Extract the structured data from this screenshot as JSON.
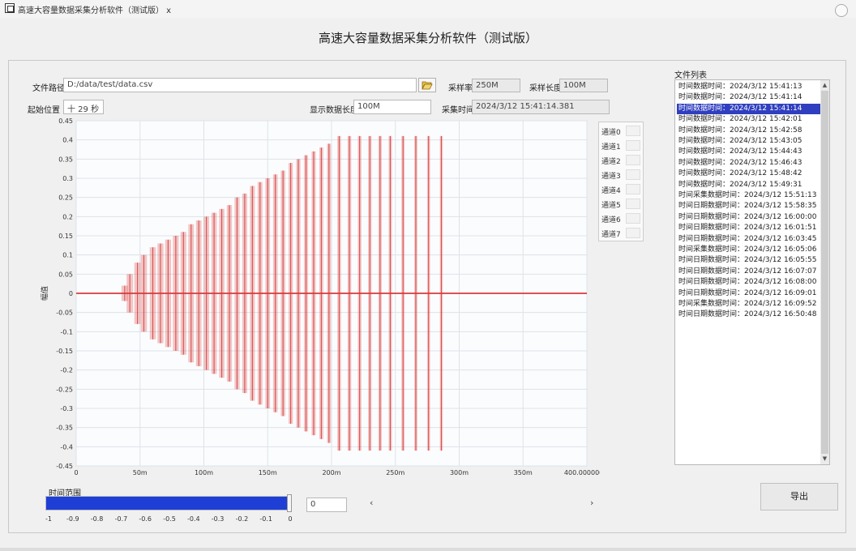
{
  "window": {
    "title": "高速大容量数据采集分析软件（测试版） x",
    "close_icon": "close-icon"
  },
  "app_heading": "高速大容量数据采集分析软件（测试版）",
  "form": {
    "file_path_label": "文件路径",
    "file_path_value": "D:/data/test/data.csv",
    "browse_icon": "folder-open-icon",
    "sample_rate_label": "采样率",
    "sample_rate_value": "250M",
    "bandwidth_label": "采样长度",
    "bandwidth_value": "100M",
    "position_label": "起始位置",
    "position_value": "十 29 秒",
    "display_length_label": "显示数据长度",
    "display_length_value": "100M",
    "time_label": "采集时间",
    "time_value": "2024/3/12 15:41:14.381"
  },
  "chart_data": {
    "type": "line",
    "title": "",
    "xlabel": "",
    "ylabel": "幅值",
    "ylim": [
      -0.45,
      0.45
    ],
    "xlim": [
      0,
      400000000
    ],
    "yticks": [
      "0.45",
      "0.4",
      "0.35",
      "0.3",
      "0.25",
      "0.2",
      "0.15",
      "0.1",
      "0.05",
      "0",
      "-0.05",
      "-0.1",
      "-0.15",
      "-0.2",
      "-0.25",
      "-0.3",
      "-0.35",
      "-0.4",
      "-0.45"
    ],
    "xticks": [
      "0",
      "50m",
      "100m",
      "150m",
      "200m",
      "250m",
      "300m",
      "350m",
      "400.000000m"
    ],
    "grid": true,
    "series_color": "#d83a3a",
    "series": [
      {
        "name": "",
        "bursts": [
          {
            "x": 38000000,
            "amp": 0.02
          },
          {
            "x": 42000000,
            "amp": 0.05
          },
          {
            "x": 48000000,
            "amp": 0.08
          },
          {
            "x": 53000000,
            "amp": 0.1
          },
          {
            "x": 60000000,
            "amp": 0.12
          },
          {
            "x": 66000000,
            "amp": 0.13
          },
          {
            "x": 72000000,
            "amp": 0.14
          },
          {
            "x": 78000000,
            "amp": 0.15
          },
          {
            "x": 84000000,
            "amp": 0.16
          },
          {
            "x": 90000000,
            "amp": 0.18
          },
          {
            "x": 96000000,
            "amp": 0.19
          },
          {
            "x": 102000000,
            "amp": 0.2
          },
          {
            "x": 108000000,
            "amp": 0.21
          },
          {
            "x": 114000000,
            "amp": 0.22
          },
          {
            "x": 120000000,
            "amp": 0.23
          },
          {
            "x": 126000000,
            "amp": 0.25
          },
          {
            "x": 132000000,
            "amp": 0.26
          },
          {
            "x": 138000000,
            "amp": 0.28
          },
          {
            "x": 144000000,
            "amp": 0.29
          },
          {
            "x": 150000000,
            "amp": 0.3
          },
          {
            "x": 156000000,
            "amp": 0.31
          },
          {
            "x": 162000000,
            "amp": 0.32
          },
          {
            "x": 168000000,
            "amp": 0.34
          },
          {
            "x": 174000000,
            "amp": 0.35
          },
          {
            "x": 180000000,
            "amp": 0.36
          },
          {
            "x": 186000000,
            "amp": 0.37
          },
          {
            "x": 192000000,
            "amp": 0.38
          },
          {
            "x": 198000000,
            "amp": 0.39
          },
          {
            "x": 206000000,
            "amp": 0.41
          },
          {
            "x": 214000000,
            "amp": 0.41
          },
          {
            "x": 222000000,
            "amp": 0.41
          },
          {
            "x": 230000000,
            "amp": 0.41
          },
          {
            "x": 238000000,
            "amp": 0.41
          },
          {
            "x": 246000000,
            "amp": 0.41
          },
          {
            "x": 256000000,
            "amp": 0.41
          },
          {
            "x": 266000000,
            "amp": 0.41
          },
          {
            "x": 276000000,
            "amp": 0.41
          },
          {
            "x": 286000000,
            "amp": 0.41
          }
        ]
      }
    ]
  },
  "legend": {
    "items": [
      {
        "label": "通道0"
      },
      {
        "label": "通道1"
      },
      {
        "label": "通道2"
      },
      {
        "label": "通道3"
      },
      {
        "label": "通道4"
      },
      {
        "label": "通道5"
      },
      {
        "label": "通道6"
      },
      {
        "label": "通道7"
      }
    ]
  },
  "file_list": {
    "label": "文件列表",
    "items": [
      "时间数据时间：2024/3/12 15:41:13",
      "时间数据时间：2024/3/12 15:41:14",
      "时间数据时间：2024/3/12 15:41:14",
      "时间数据时间：2024/3/12 15:42:01",
      "时间数据时间：2024/3/12 15:42:58",
      "时间数据时间：2024/3/12 15:43:05",
      "时间数据时间：2024/3/12 15:44:43",
      "时间数据时间：2024/3/12 15:46:43",
      "时间数据时间：2024/3/12 15:48:42",
      "时间数据时间：2024/3/12 15:49:31",
      "时间采集数据时间：2024/3/12 15:51:13",
      "时间日期数据时间：2024/3/12 15:58:35",
      "时间日期数据时间：2024/3/12 16:00:00",
      "时间日期数据时间：2024/3/12 16:01:51",
      "时间日期数据时间：2024/3/12 16:03:45",
      "时间采集数据时间：2024/3/12 16:05:06",
      "时间日期数据时间：2024/3/12 16:05:55",
      "时间日期数据时间：2024/3/12 16:07:07",
      "时间日期数据时间：2024/3/12 16:08:00",
      "时间日期数据时间：2024/3/12 16:09:01",
      "时间采集数据时间：2024/3/12 16:09:52",
      "时间日期数据时间：2024/3/12 16:50:48"
    ],
    "selected_index": 2
  },
  "progress": {
    "label": "时间范围",
    "fraction": 1.0,
    "value_field": "0",
    "ticks": [
      "-1",
      "-0.9",
      "-0.8",
      "-0.7",
      "-0.6",
      "-0.5",
      "-0.4",
      "-0.3",
      "-0.2",
      "-0.1",
      "0"
    ]
  },
  "scroll_left_label": "‹",
  "scroll_right_label": "›",
  "export_button": "导出",
  "colors": {
    "accent": "#1d3fd6",
    "selection": "#2f3fbf",
    "signal": "#d83a3a"
  }
}
